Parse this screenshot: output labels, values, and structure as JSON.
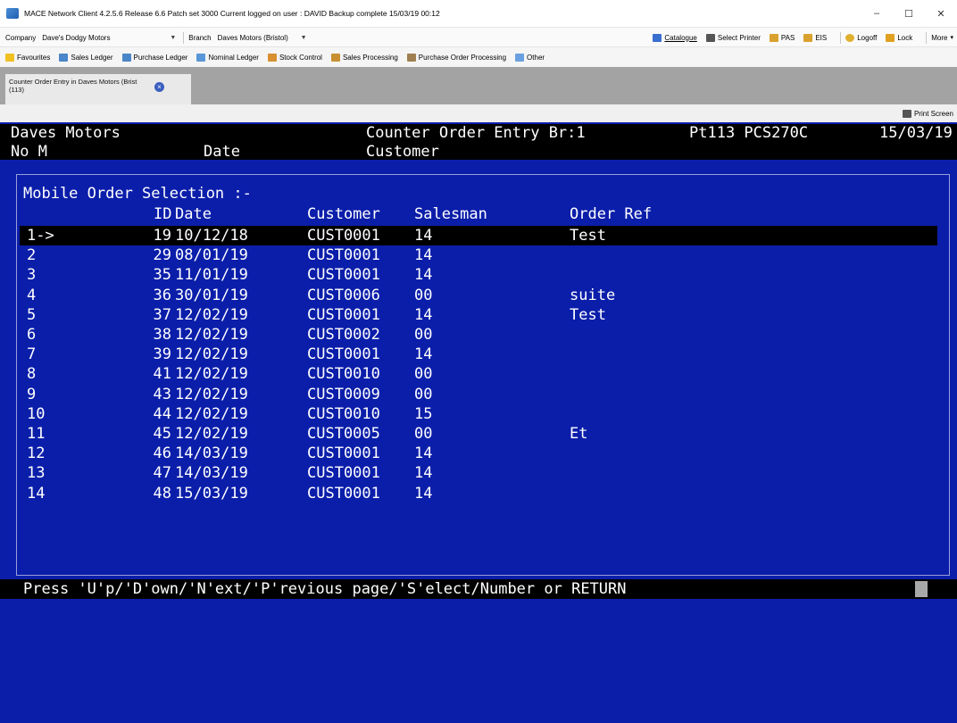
{
  "window": {
    "title": "MACE Network Client 4.2.5.6   Release 6.6 Patch set 3000   Current logged on user : DAVID    Backup complete 15/03/19 00:12",
    "minimize": "–",
    "maximize": "☐",
    "close": "✕"
  },
  "company_bar": {
    "company_label": "Company",
    "company_value": "Dave's Dodgy Motors",
    "branch_label": "Branch",
    "branch_value": "Daves Motors (Bristol)",
    "catalogue": "Catalogue",
    "select_printer": "Select Printer",
    "pas": "PAS",
    "eis": "EIS",
    "logoff": "Logoff",
    "lock": "Lock",
    "more": "More"
  },
  "favourites_bar": {
    "items": [
      "Favourites",
      "Sales Ledger",
      "Purchase Ledger",
      "Nominal Ledger",
      "Stock Control",
      "Sales Processing",
      "Purchase Order Processing",
      "Other"
    ]
  },
  "tab": {
    "title_line1": "Counter Order Entry in Daves Motors (Brist",
    "title_line2": "(113)",
    "close": "×"
  },
  "print_screen": "Print Screen",
  "terminal": {
    "header_company": "Daves Motors",
    "header_title": "Counter Order Entry Br:1",
    "header_program": "Pt113 PCS270C",
    "header_date": "15/03/19",
    "sub_no": "No M",
    "sub_date": "Date",
    "sub_customer": "Customer",
    "panel_title": "Mobile Order Selection :-",
    "columns": {
      "id": "ID",
      "date": "Date",
      "customer": "Customer",
      "salesman": "Salesman",
      "order_ref": "Order Ref"
    },
    "rows": [
      {
        "no": "1->",
        "id": "19",
        "date": "10/12/18",
        "customer": "CUST0001",
        "salesman": "14",
        "ref": "Test"
      },
      {
        "no": "2",
        "id": "29",
        "date": "08/01/19",
        "customer": "CUST0001",
        "salesman": "14",
        "ref": ""
      },
      {
        "no": "3",
        "id": "35",
        "date": "11/01/19",
        "customer": "CUST0001",
        "salesman": "14",
        "ref": ""
      },
      {
        "no": "4",
        "id": "36",
        "date": "30/01/19",
        "customer": "CUST0006",
        "salesman": "00",
        "ref": "suite"
      },
      {
        "no": "5",
        "id": "37",
        "date": "12/02/19",
        "customer": "CUST0001",
        "salesman": "14",
        "ref": "Test"
      },
      {
        "no": "6",
        "id": "38",
        "date": "12/02/19",
        "customer": "CUST0002",
        "salesman": "00",
        "ref": ""
      },
      {
        "no": "7",
        "id": "39",
        "date": "12/02/19",
        "customer": "CUST0001",
        "salesman": "14",
        "ref": ""
      },
      {
        "no": "8",
        "id": "41",
        "date": "12/02/19",
        "customer": "CUST0010",
        "salesman": "00",
        "ref": ""
      },
      {
        "no": "9",
        "id": "43",
        "date": "12/02/19",
        "customer": "CUST0009",
        "salesman": "00",
        "ref": ""
      },
      {
        "no": "10",
        "id": "44",
        "date": "12/02/19",
        "customer": "CUST0010",
        "salesman": "15",
        "ref": ""
      },
      {
        "no": "11",
        "id": "45",
        "date": "12/02/19",
        "customer": "CUST0005",
        "salesman": "00",
        "ref": "Et"
      },
      {
        "no": "12",
        "id": "46",
        "date": "14/03/19",
        "customer": "CUST0001",
        "salesman": "14",
        "ref": ""
      },
      {
        "no": "13",
        "id": "47",
        "date": "14/03/19",
        "customer": "CUST0001",
        "salesman": "14",
        "ref": ""
      },
      {
        "no": "14",
        "id": "48",
        "date": "15/03/19",
        "customer": "CUST0001",
        "salesman": "14",
        "ref": ""
      }
    ],
    "prompt": "Press 'U'p/'D'own/'N'ext/'P'revious page/'S'elect/Number or RETURN"
  },
  "colors": {
    "terminal_bg": "#0b1eaa",
    "terminal_fg": "#ffffff",
    "header_bg": "#000000",
    "tab_strip": "#a3a3a3"
  }
}
